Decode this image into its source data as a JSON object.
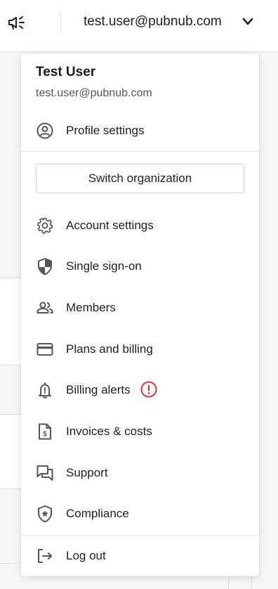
{
  "header": {
    "announce_icon": "megaphone-icon",
    "account_email": "test.user@pubnub.com",
    "chevron_icon": "chevron-down-icon"
  },
  "menu": {
    "user_name": "Test User",
    "user_email": "test.user@pubnub.com",
    "profile_settings": {
      "label": "Profile settings",
      "icon": "user-circle-icon"
    },
    "switch_org_label": "Switch organization",
    "items": [
      {
        "label": "Account settings",
        "icon": "gear-icon"
      },
      {
        "label": "Single sign-on",
        "icon": "shield-icon"
      },
      {
        "label": "Members",
        "icon": "members-icon"
      },
      {
        "label": "Plans and billing",
        "icon": "credit-card-icon"
      },
      {
        "label": "Billing alerts",
        "icon": "bell-alert-icon",
        "badge": "alert-exclamation-icon"
      },
      {
        "label": "Invoices & costs",
        "icon": "invoice-icon"
      },
      {
        "label": "Support",
        "icon": "chat-icon"
      },
      {
        "label": "Compliance",
        "icon": "shield-star-icon"
      }
    ],
    "logout": {
      "label": "Log out",
      "icon": "logout-icon"
    }
  },
  "colors": {
    "alert_red": "#e0323c",
    "icon_gray": "#55555e",
    "text": "#1f1f24"
  }
}
